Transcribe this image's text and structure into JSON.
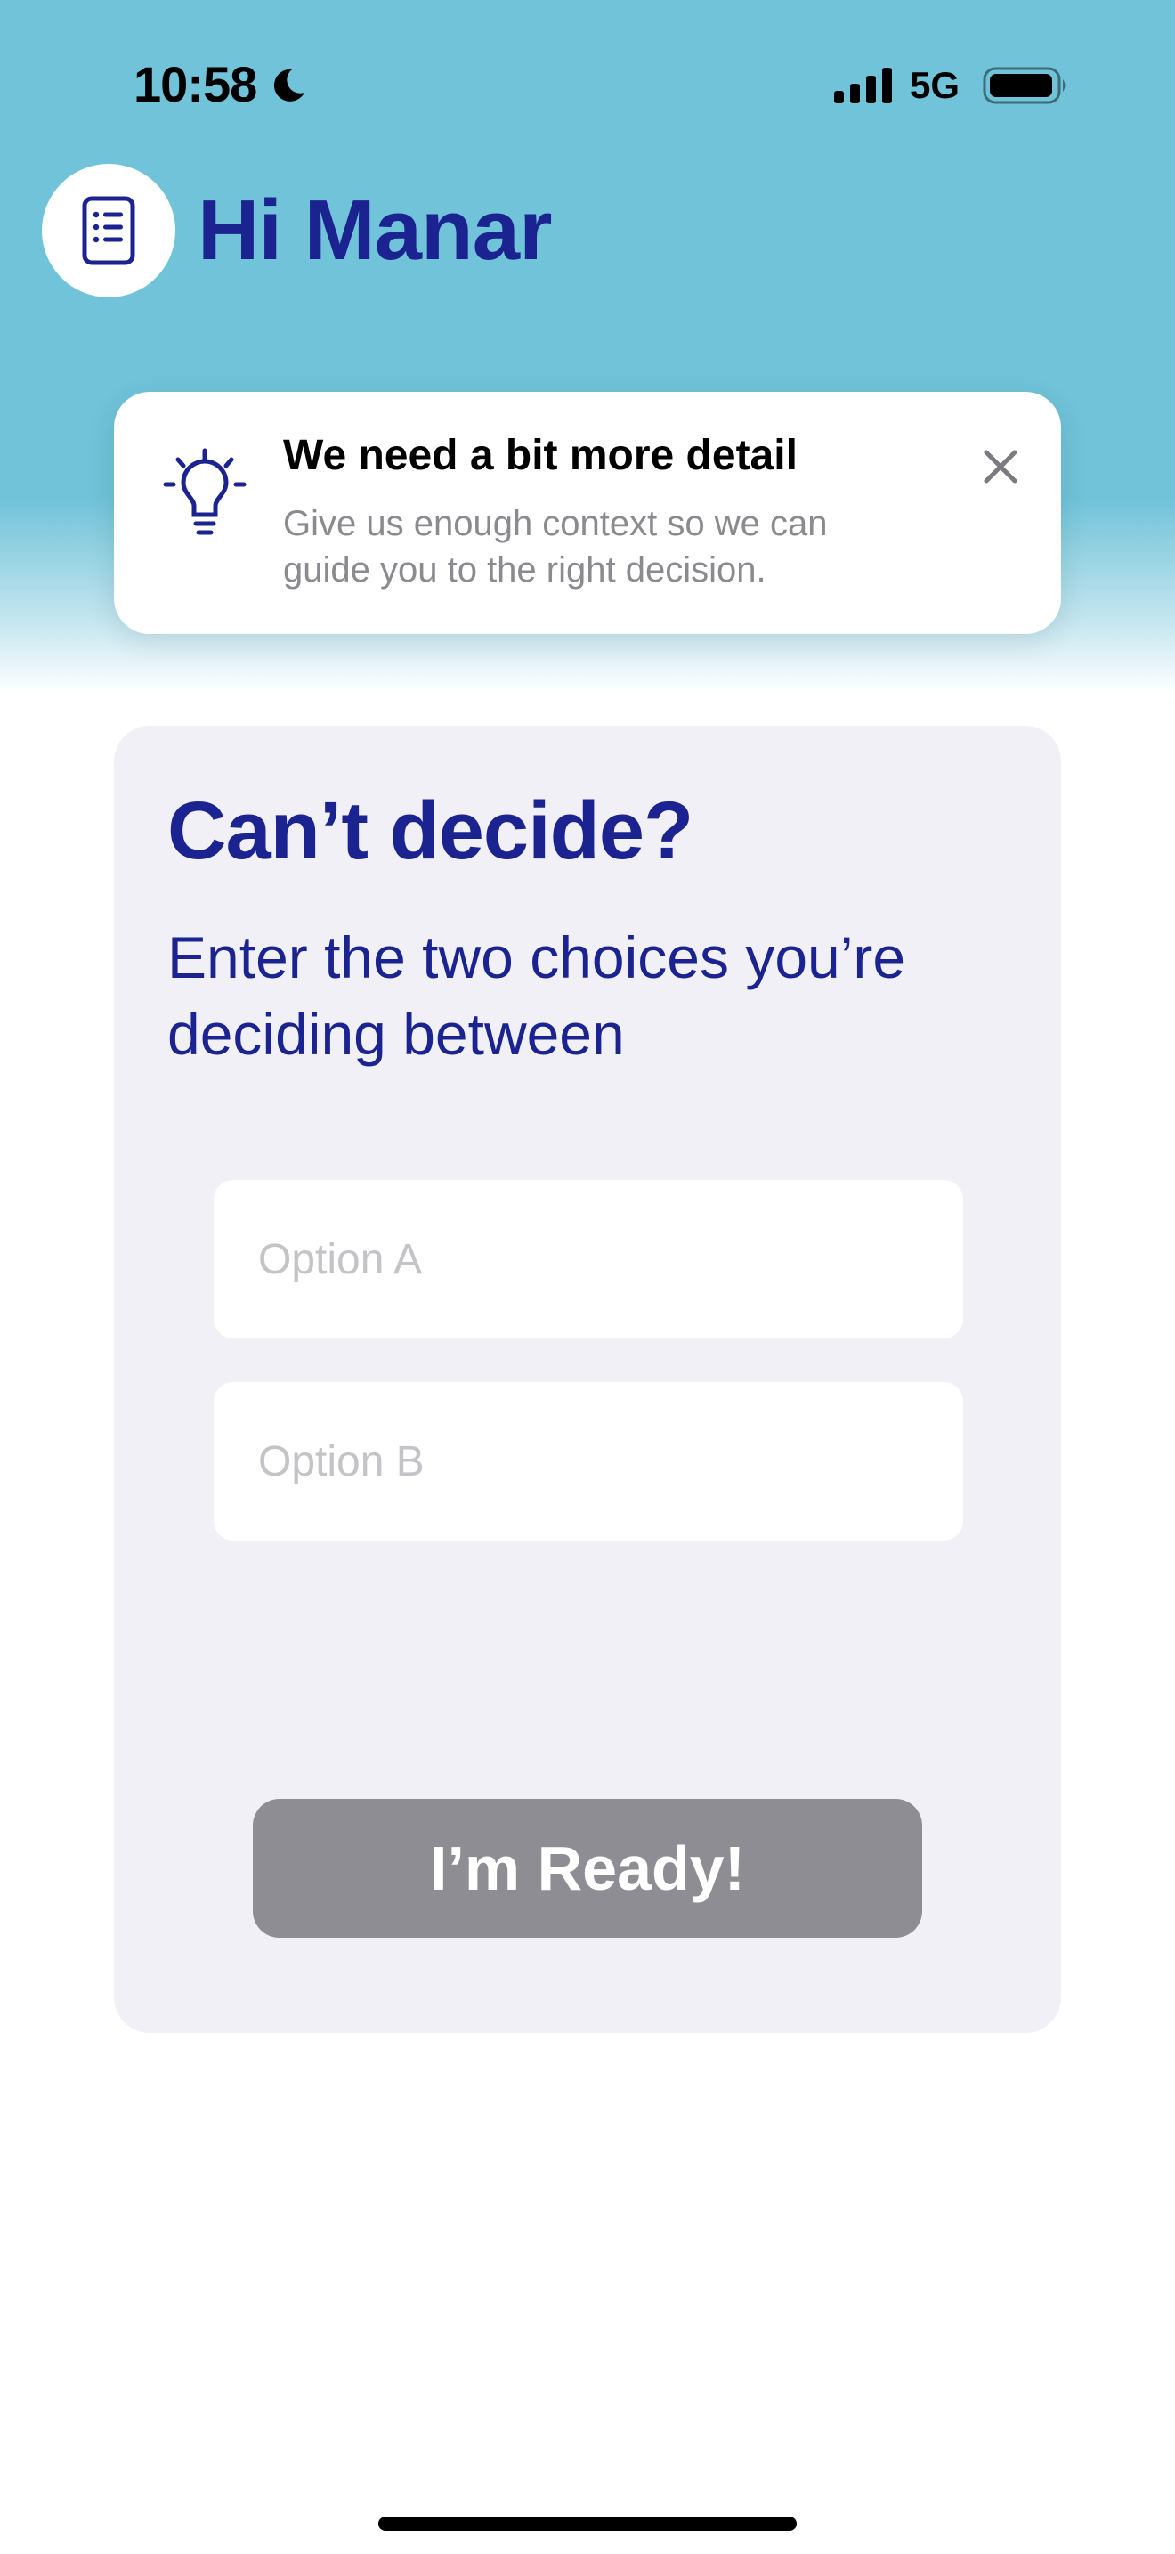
{
  "status_bar": {
    "time": "10:58",
    "network": "5G",
    "focus_icon": "moon-icon",
    "signal_icon": "signal-icon",
    "battery_icon": "battery-icon"
  },
  "header": {
    "greeting": "Hi Manar",
    "avatar_icon": "document-list-icon"
  },
  "banner": {
    "icon": "lightbulb-icon",
    "title": "We need a bit more detail",
    "message": "Give us enough context so we can guide you to the right decision.",
    "close_icon": "close-icon"
  },
  "card": {
    "title": "Can’t decide?",
    "subtitle": "Enter the two choices you’re deciding between",
    "option_a": {
      "value": "",
      "placeholder": "Option A"
    },
    "option_b": {
      "value": "",
      "placeholder": "Option B"
    },
    "submit_label": "I’m Ready!"
  },
  "colors": {
    "header_background": "#70c3d8",
    "brand_navy": "#1b2390",
    "card_background": "#f1f0f7",
    "button_disabled": "#8e8d93"
  }
}
